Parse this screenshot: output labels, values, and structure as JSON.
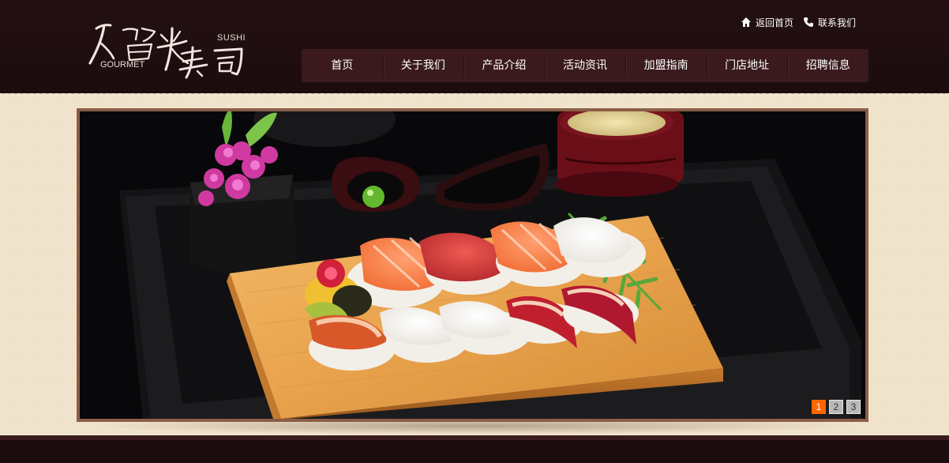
{
  "logo": {
    "brand_cn": "籀米寿司",
    "gourmet": "GOURMET",
    "sushi": "SUSHI"
  },
  "toplinks": [
    {
      "label": "返回首页",
      "icon": "home-icon"
    },
    {
      "label": "联系我们",
      "icon": "phone-icon"
    }
  ],
  "nav": {
    "items": [
      "首页",
      "关于我们",
      "产品介绍",
      "活动资讯",
      "加盟指南",
      "门店地址",
      "招聘信息"
    ]
  },
  "banner": {
    "pager": [
      "1",
      "2",
      "3"
    ],
    "active_index": 0
  },
  "colors": {
    "header_bg": "#1c0c0e",
    "nav_bg": "#3a1a1d",
    "page_bg": "#f2e4cc",
    "banner_border": "#8a5e47",
    "pager_active": "#ff6600"
  }
}
